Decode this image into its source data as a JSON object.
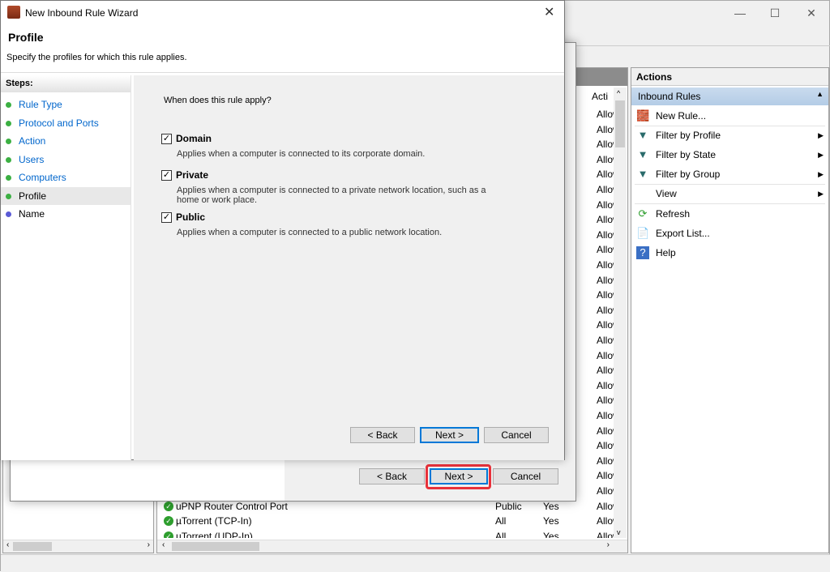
{
  "main_window": {
    "controls": {
      "minimize": "—",
      "maximize": "☐",
      "close": "✕"
    },
    "middle": {
      "column_action": "Acti",
      "rows": [
        {
          "action": "Allow"
        },
        {
          "action": "Allow"
        },
        {
          "action": "Allow"
        },
        {
          "action": "Allow"
        },
        {
          "action": "Allow"
        },
        {
          "action": "Allow"
        },
        {
          "action": "Allow"
        },
        {
          "action": "Allow"
        },
        {
          "action": "Allow"
        },
        {
          "action": "Allow"
        },
        {
          "action": "Allow"
        },
        {
          "action": "Allow"
        },
        {
          "action": "Allow"
        },
        {
          "action": "Allow"
        },
        {
          "action": "Allow"
        },
        {
          "action": "Allow"
        },
        {
          "action": "Allow"
        },
        {
          "action": "Allow"
        },
        {
          "action": "Allow"
        },
        {
          "action": "Allow"
        },
        {
          "action": "Allow"
        },
        {
          "action": "Allow"
        },
        {
          "action": "Allow"
        },
        {
          "action": "Allow"
        },
        {
          "action": "Allow"
        },
        {
          "action": "Allow"
        },
        {
          "name": "uPNP Router Control Port",
          "profile": "Public",
          "enabled": "Yes",
          "action": "Allow"
        },
        {
          "name": "µTorrent (TCP-In)",
          "profile": "All",
          "enabled": "Yes",
          "action": "Allow"
        },
        {
          "name": "µTorrent (UDP-In)",
          "profile": "All",
          "enabled": "Yes",
          "action": "Allow"
        }
      ]
    },
    "actions": {
      "title": "Actions",
      "section": "Inbound Rules",
      "items": [
        {
          "label": "New Rule...",
          "icon": "new-rule-icon",
          "glyph": "🧱",
          "submenu": false
        },
        {
          "label": "Filter by Profile",
          "icon": "filter-icon",
          "glyph": "▼",
          "submenu": true
        },
        {
          "label": "Filter by State",
          "icon": "filter-icon",
          "glyph": "▼",
          "submenu": true
        },
        {
          "label": "Filter by Group",
          "icon": "filter-icon",
          "glyph": "▼",
          "submenu": true
        },
        {
          "label": "View",
          "icon": "",
          "glyph": "",
          "submenu": true
        },
        {
          "label": "Refresh",
          "icon": "refresh-icon",
          "glyph": "⟳",
          "submenu": false
        },
        {
          "label": "Export List...",
          "icon": "export-icon",
          "glyph": "📄",
          "submenu": false
        },
        {
          "label": "Help",
          "icon": "help-icon",
          "glyph": "?",
          "submenu": false
        }
      ]
    }
  },
  "back_dialog": {
    "back": "< Back",
    "next": "Next >",
    "cancel": "Cancel"
  },
  "wizard": {
    "title": "New Inbound Rule Wizard",
    "close": "✕",
    "heading": "Profile",
    "subheading": "Specify the profiles for which this rule applies.",
    "steps_label": "Steps:",
    "steps": [
      {
        "label": "Rule Type"
      },
      {
        "label": "Protocol and Ports"
      },
      {
        "label": "Action"
      },
      {
        "label": "Users"
      },
      {
        "label": "Computers"
      },
      {
        "label": "Profile",
        "selected": true
      },
      {
        "label": "Name",
        "pending": true
      }
    ],
    "question": "When does this rule apply?",
    "options": [
      {
        "label": "Domain",
        "checked": true,
        "description": "Applies when a computer is connected to its corporate domain."
      },
      {
        "label": "Private",
        "checked": true,
        "description": "Applies when a computer is connected to a private network location, such as a home or work place."
      },
      {
        "label": "Public",
        "checked": true,
        "description": "Applies when a computer is connected to a public network location."
      }
    ],
    "back": "< Back",
    "next": "Next >",
    "cancel": "Cancel",
    "highlight_color": "#e8313a"
  }
}
